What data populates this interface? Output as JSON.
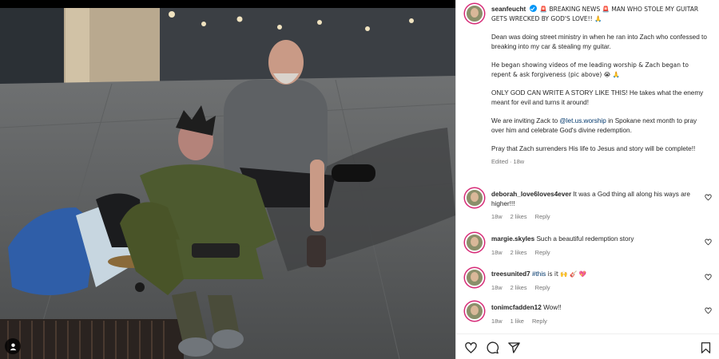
{
  "post": {
    "username": "seanfeucht",
    "caption_lines": [
      "🚨 BREAKING NEWS 🚨 MAN WHO STOLE MY GUITAR GETS WRECKED BY GOD'S LOVE!! 🙏",
      "Dean was doing street ministry in when he ran into Zach who confessed to breaking into my car & stealing my guitar.",
      "He began showing videos of me leading worship & Zach began to repent & ask forgiveness (pic above) 😭 🙏",
      "ONLY GOD CAN WRITE A STORY LIKE THIS! He takes what the enemy meant for evil and turns it around!",
      "We are inviting Zack to",
      "@let.us.worship",
      "in Spokane next month to pray over him and celebrate God's divine redemption.",
      "Pray that Zach surrenders His life to Jesus and story will be complete!!"
    ],
    "edited_label": "Edited",
    "age": "18w"
  },
  "comments": [
    {
      "username": "deborah_love6loves4ever",
      "text": "It was a God thing all along his ways are higher!!!",
      "age": "18w",
      "likes": "2 likes",
      "reply": "Reply"
    },
    {
      "username": "margie.skyles",
      "text": "Such a beautiful redemption story",
      "age": "18w",
      "likes": "2 likes",
      "reply": "Reply"
    },
    {
      "username": "treesunited7",
      "hashtag": "#this",
      "text": "is it 🙌 🎸 💖",
      "age": "18w",
      "likes": "2 likes",
      "reply": "Reply"
    },
    {
      "username": "tonimcfadden12",
      "text": "Wow!!",
      "age": "18w",
      "likes": "1 like",
      "reply": "Reply"
    }
  ],
  "icons": {
    "like": "heart-icon",
    "comment": "comment-icon",
    "share": "share-icon",
    "save": "bookmark-icon",
    "tag": "user-tag-icon"
  },
  "colors": {
    "link": "#00376b",
    "verified": "#0095f6",
    "meta": "#737373",
    "text": "#262626"
  }
}
